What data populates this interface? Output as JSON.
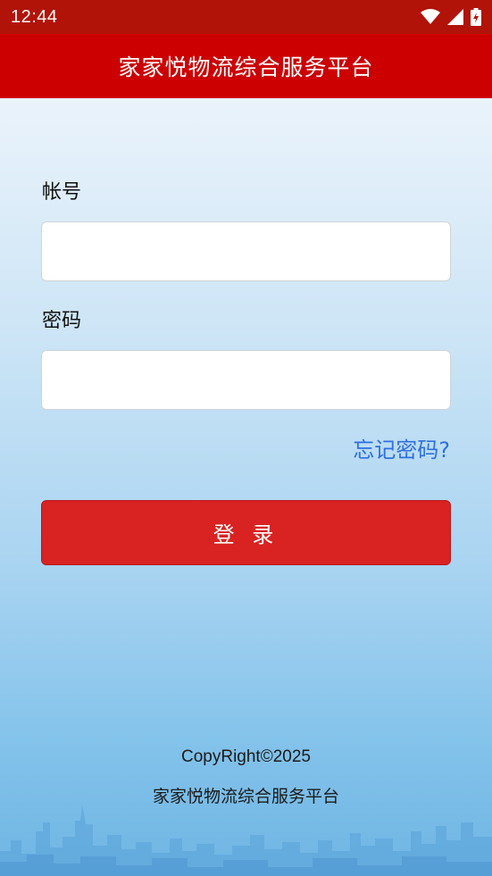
{
  "status_bar": {
    "time": "12:44",
    "icons": [
      "wifi-icon",
      "signal-icon",
      "battery-charging-icon"
    ]
  },
  "app_bar": {
    "title": "家家悦物流综合服务平台"
  },
  "login_form": {
    "account_label": "帐号",
    "account_value": "",
    "password_label": "密码",
    "password_value": "",
    "forgot_password": "忘记密码?",
    "login_button": "登 录"
  },
  "footer": {
    "copyright": "CopyRight©2025",
    "platform_name": "家家悦物流综合服务平台"
  },
  "colors": {
    "status_bar": "#b11309",
    "app_bar": "#cd0000",
    "login_button": "#d92222",
    "link": "#2f6fe0"
  }
}
